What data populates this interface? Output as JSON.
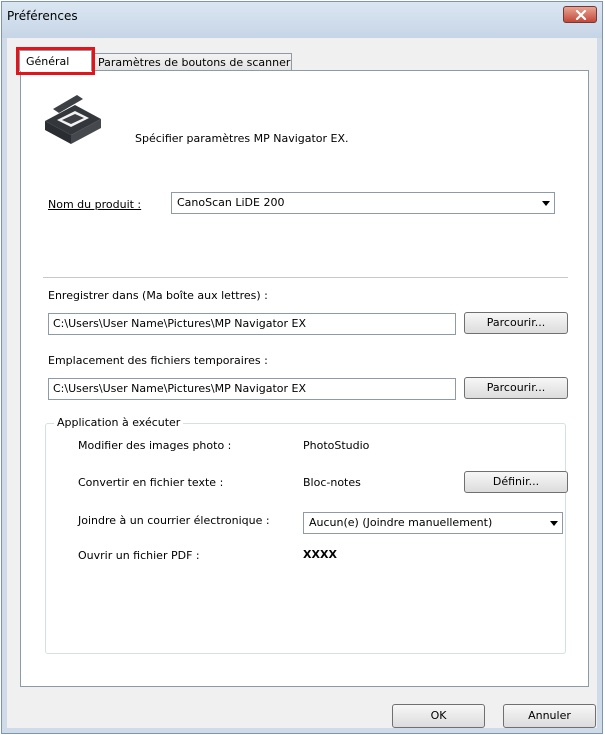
{
  "window": {
    "title": "Préférences"
  },
  "tabs": [
    {
      "label": "Général"
    },
    {
      "label": "Paramètres de boutons de scanner"
    }
  ],
  "header": {
    "description": "Spécifier paramètres MP Navigator EX."
  },
  "product": {
    "label": "Nom du produit :",
    "value": "CanoScan LiDE 200"
  },
  "save_location": {
    "label": "Enregistrer dans (Ma boîte aux lettres) :",
    "value": "C:\\Users\\User Name\\Pictures\\MP Navigator EX",
    "button": "Parcourir..."
  },
  "temp_location": {
    "label": "Emplacement des fichiers temporaires :",
    "value": "C:\\Users\\User Name\\Pictures\\MP Navigator EX",
    "button": "Parcourir..."
  },
  "apps": {
    "title": "Application à exécuter",
    "edit_photo": {
      "label": "Modifier des images photo :",
      "value": "PhotoStudio"
    },
    "convert_text": {
      "label": "Convertir en fichier texte :",
      "value": "Bloc-notes",
      "button": "Définir..."
    },
    "attach_email": {
      "label": "Joindre à un courrier électronique :",
      "value": "Aucun(e) (Joindre manuellement)"
    },
    "open_pdf": {
      "label": "Ouvrir un fichier PDF :",
      "value": "XXXX"
    }
  },
  "footer": {
    "ok": "OK",
    "cancel": "Annuler"
  },
  "colors": {
    "highlight": "#e4141b",
    "close_button": "#c2483a",
    "window_frame": "#cfdbe8"
  },
  "icons": {
    "close": "close-icon",
    "scanner": "scanner-icon"
  }
}
